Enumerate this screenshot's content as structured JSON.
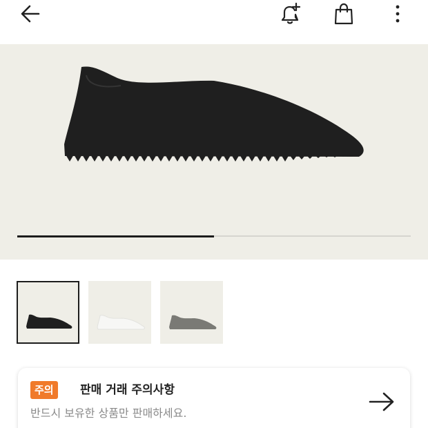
{
  "header": {
    "back_icon": "arrow-left-icon",
    "notify_icon": "bell-plus-icon",
    "bag_icon": "shopping-bag-icon",
    "more_icon": "more-vertical-icon"
  },
  "gallery": {
    "background_color": "#efeee7",
    "progress_fraction": 0.5,
    "thumbnails": [
      {
        "color": "#1f1f1f",
        "selected": true
      },
      {
        "color": "#f4f4f2",
        "selected": false
      },
      {
        "color": "#7a7a75",
        "selected": false
      }
    ]
  },
  "notice": {
    "badge": "주의",
    "title": "판매 거래 주의사항",
    "description": "반드시 보유한 상품만 판매하세요.",
    "badge_color": "#f07a2a",
    "arrow_icon": "arrow-right-icon"
  }
}
